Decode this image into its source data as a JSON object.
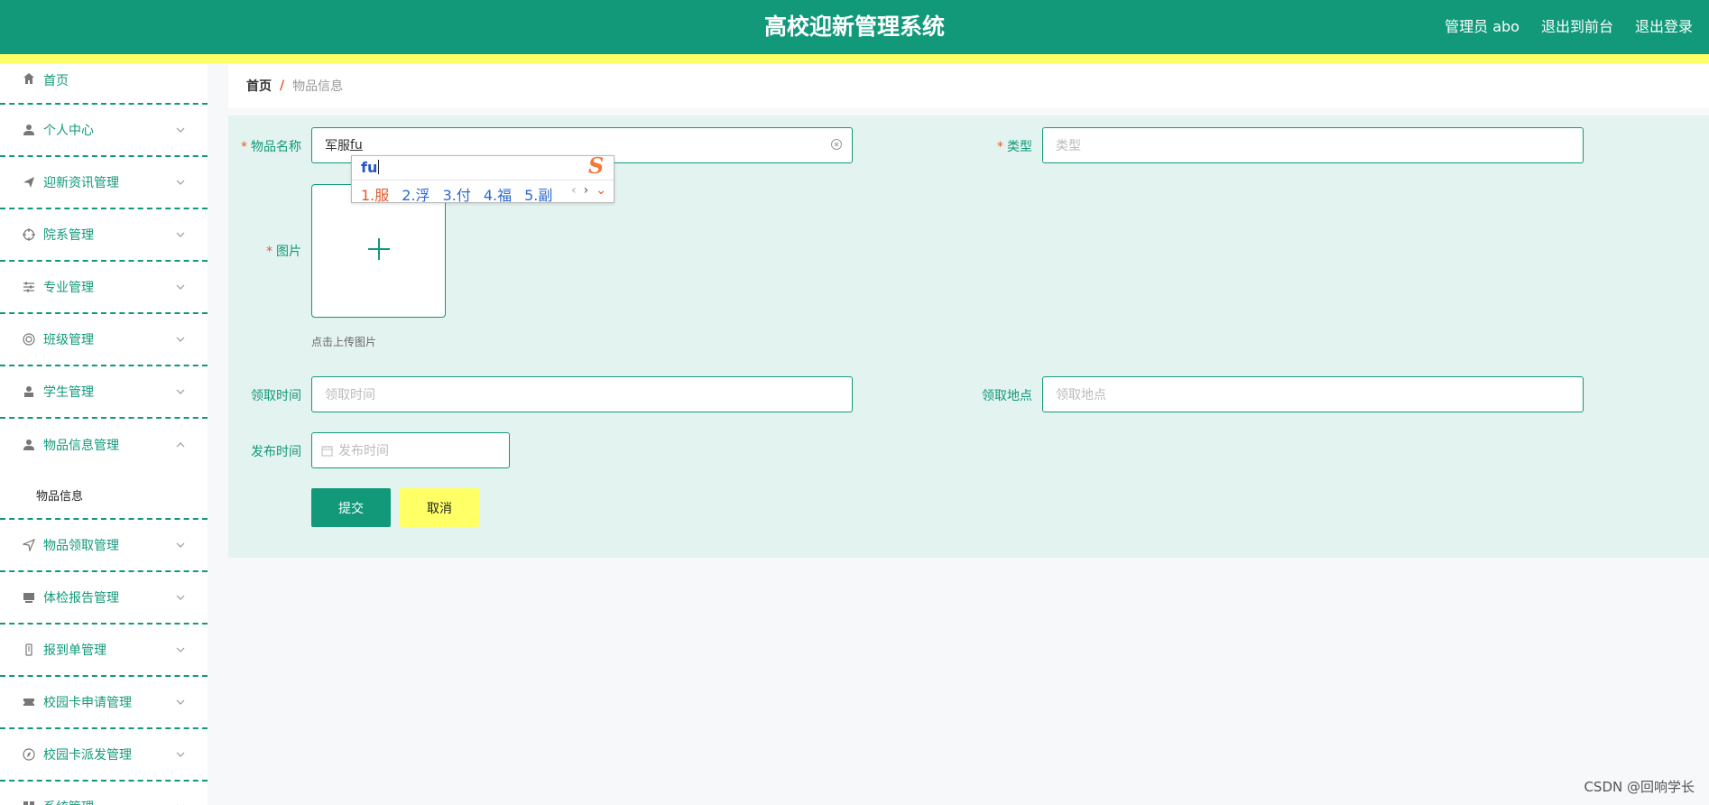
{
  "header": {
    "title": "高校迎新管理系统",
    "admin": "管理员 abo",
    "to_front": "退出到前台",
    "logout": "退出登录",
    "colors": {
      "primary": "#11997a",
      "stripe": "#ffff66"
    }
  },
  "sidebar": {
    "items": [
      {
        "label": "首页",
        "icon": "home-icon"
      },
      {
        "label": "个人中心",
        "icon": "user-icon"
      },
      {
        "label": "迎新资讯管理",
        "icon": "send-icon"
      },
      {
        "label": "院系管理",
        "icon": "target-icon"
      },
      {
        "label": "专业管理",
        "icon": "sliders-icon"
      },
      {
        "label": "班级管理",
        "icon": "circle-icon"
      },
      {
        "label": "学生管理",
        "icon": "student-icon"
      },
      {
        "label": "物品信息管理",
        "icon": "user-icon"
      },
      {
        "label": "物品领取管理",
        "icon": "location-icon"
      },
      {
        "label": "体检报告管理",
        "icon": "box-icon"
      },
      {
        "label": "报到单管理",
        "icon": "phone-icon"
      },
      {
        "label": "校园卡申请管理",
        "icon": "ticket-icon"
      },
      {
        "label": "校园卡派发管理",
        "icon": "compass-icon"
      },
      {
        "label": "系统管理",
        "icon": "grid-icon"
      }
    ],
    "sub_item": "物品信息"
  },
  "breadcrumb": {
    "home": "首页",
    "sep": "/",
    "current": "物品信息"
  },
  "form": {
    "name_label": "物品名称",
    "name_value": "军服",
    "name_composing": "fu",
    "type_label": "类型",
    "type_placeholder": "类型",
    "image_label": "图片",
    "upload_hint": "点击上传图片",
    "time_label": "领取时间",
    "time_placeholder": "领取时间",
    "place_label": "领取地点",
    "place_placeholder": "领取地点",
    "publish_label": "发布时间",
    "publish_placeholder": "发布时间",
    "submit": "提交",
    "cancel": "取消",
    "required_mark": "*"
  },
  "ime": {
    "composition": "fu",
    "candidates": [
      "1.服",
      "2.浮",
      "3.付",
      "4.福",
      "5.副"
    ],
    "logo": "S"
  },
  "watermark": "CSDN @回响学长"
}
